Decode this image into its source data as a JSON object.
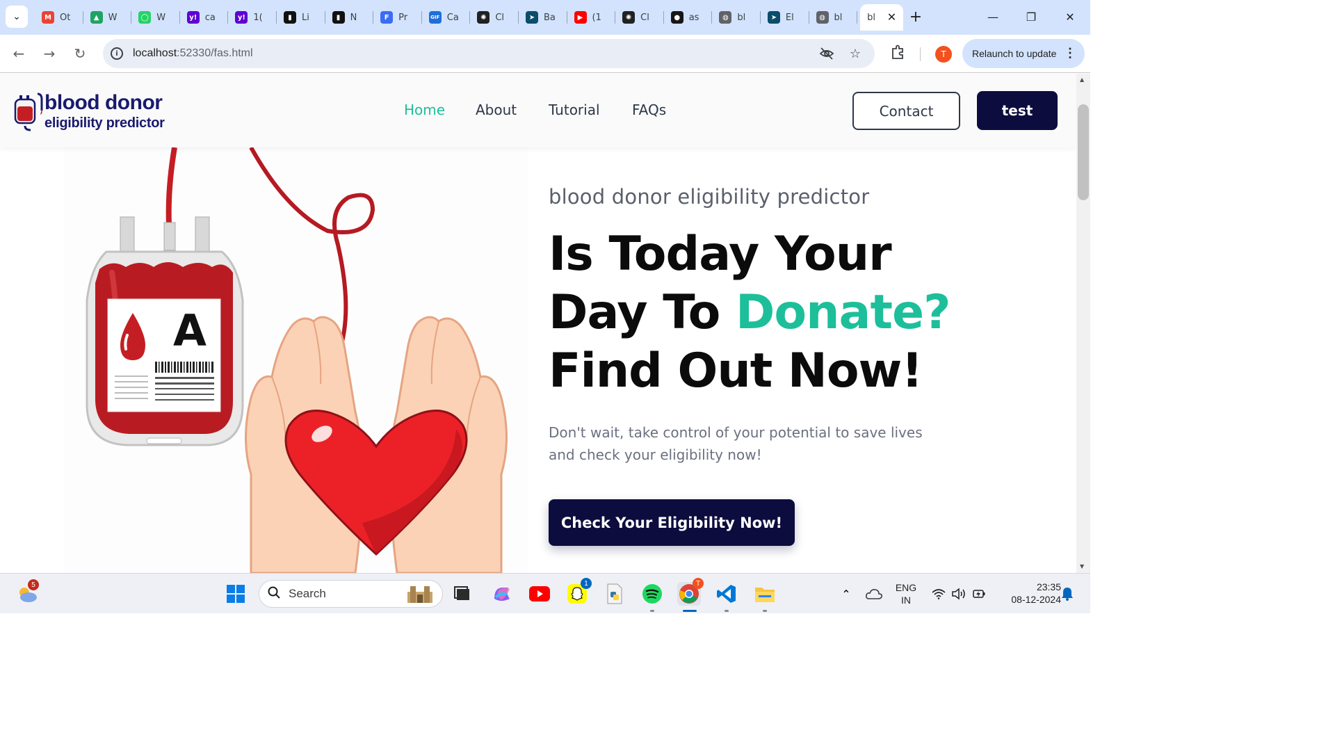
{
  "browser": {
    "tabs": [
      {
        "label": "Ot",
        "icon": "gmail-icon",
        "color": "#ea4335",
        "glyph": "M"
      },
      {
        "label": "W",
        "icon": "google-drive-icon",
        "color": "#1ea362",
        "glyph": "▲"
      },
      {
        "label": "W",
        "icon": "whatsapp-icon",
        "color": "#25d366",
        "glyph": "◯"
      },
      {
        "label": "ca",
        "icon": "yahoo-icon",
        "color": "#6001d2",
        "glyph": "y!"
      },
      {
        "label": "1(",
        "icon": "yahoo-icon",
        "color": "#6001d2",
        "glyph": "y!"
      },
      {
        "label": "Li",
        "icon": "document-icon",
        "color": "#111111",
        "glyph": "▮"
      },
      {
        "label": "N",
        "icon": "document-icon",
        "color": "#111111",
        "glyph": "▮"
      },
      {
        "label": "Pr",
        "icon": "forms-icon",
        "color": "#3b6cf6",
        "glyph": "F"
      },
      {
        "label": "Ca",
        "icon": "gif-icon",
        "color": "#1e6fd9",
        "glyph": "GIF"
      },
      {
        "label": "Cl",
        "icon": "openai-icon",
        "color": "#202123",
        "glyph": "✺"
      },
      {
        "label": "Ba",
        "icon": "cursor-icon",
        "color": "#0b4d6b",
        "glyph": "➤"
      },
      {
        "label": "(1",
        "icon": "youtube-icon",
        "color": "#ff0000",
        "glyph": "▶"
      },
      {
        "label": "Cl",
        "icon": "openai-icon",
        "color": "#202123",
        "glyph": "✺"
      },
      {
        "label": "as",
        "icon": "github-icon",
        "color": "#181717",
        "glyph": "●"
      },
      {
        "label": "bl",
        "icon": "globe-icon",
        "color": "#5f6368",
        "glyph": "◍"
      },
      {
        "label": "El",
        "icon": "cursor-icon",
        "color": "#0b4d6b",
        "glyph": "➤"
      },
      {
        "label": "bl",
        "icon": "globe-icon",
        "color": "#5f6368",
        "glyph": "◍"
      }
    ],
    "active_tab": {
      "label": "bl",
      "close": "✕"
    },
    "new_tab": "+",
    "window": {
      "minimize": "—",
      "restore": "❐",
      "close": "✕"
    },
    "url_host": "localhost",
    "url_path": ":52330/fas.html",
    "profile_initial": "T",
    "relaunch_label": "Relaunch to update"
  },
  "site": {
    "logo": {
      "line1": "blood donor",
      "line2": "eligibility predictor"
    },
    "nav": [
      {
        "label": "Home",
        "active": true
      },
      {
        "label": "About",
        "active": false
      },
      {
        "label": "Tutorial",
        "active": false
      },
      {
        "label": "FAQs",
        "active": false
      }
    ],
    "contact_label": "Contact",
    "test_label": "test",
    "hero": {
      "subtitle": "blood donor eligibility predictor",
      "title_line1": "Is Today Your",
      "title_line2_a": "Day To ",
      "title_line2_accent": "Donate?",
      "title_line3": "Find Out Now!",
      "description": "Don't wait, take control of your potential to save lives and check your eligibility now!",
      "cta": "Check Your Eligibility Now!",
      "bag_label": "A"
    },
    "colors": {
      "accent": "#1dbf9a",
      "navy": "#0c0c3e",
      "blood": "#c41e24"
    }
  },
  "taskbar": {
    "search_label": "Search",
    "weather_badge": "5",
    "snapchat_badge": "1",
    "chrome_badge": "T",
    "lang_line1": "ENG",
    "lang_line2": "IN",
    "time": "23:35",
    "date": "08-12-2024"
  }
}
